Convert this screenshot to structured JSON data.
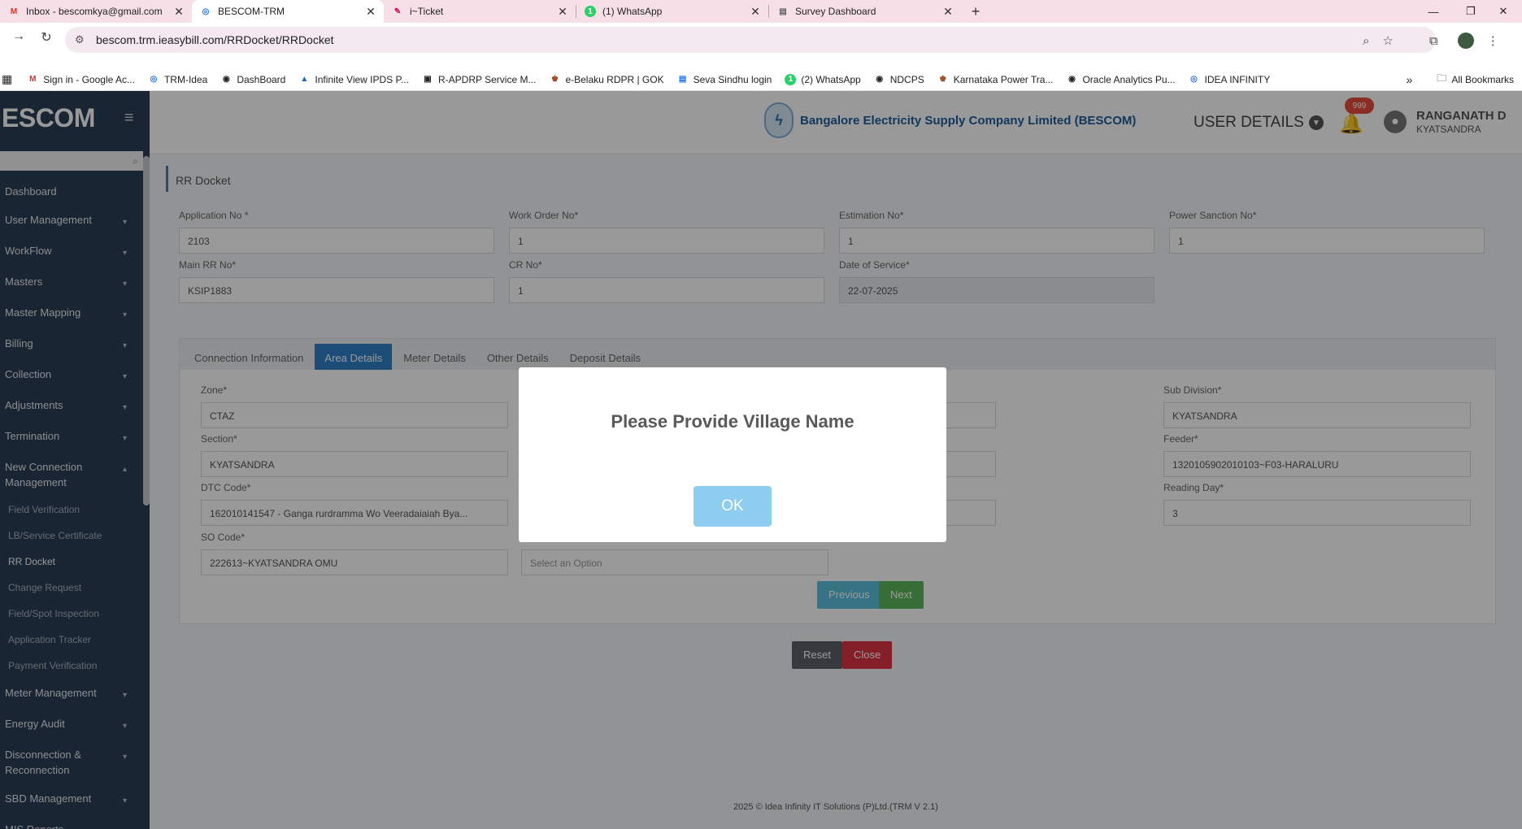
{
  "browser": {
    "tabs": [
      {
        "title": "Inbox - bescomkya@gmail.com",
        "icon": "gmail-icon",
        "color": "#d93025"
      },
      {
        "title": "BESCOM-TRM",
        "icon": "globe-icon",
        "color": "#1a73e8"
      },
      {
        "title": "i~Ticket",
        "icon": "ticket-icon",
        "color": "#c2185b"
      },
      {
        "title": "(1) WhatsApp",
        "icon": "whatsapp-icon",
        "color": "#25d366"
      },
      {
        "title": "Survey Dashboard",
        "icon": "doc-icon",
        "color": "#5f6368"
      }
    ],
    "url": "bescom.trm.ieasybill.com/RRDocket/RRDocket",
    "bookmarks": [
      "Sign in - Google Ac...",
      "TRM-Idea",
      "DashBoard",
      "Infinite View IPDS P...",
      "R-APDRP Service M...",
      "e-Belaku RDPR | GOK",
      "Seva Sindhu login",
      "(2) WhatsApp",
      "NDCPS",
      "Karnataka Power Tra...",
      "Oracle Analytics Pu...",
      "IDEA INFINITY"
    ],
    "all_bookmarks": "All Bookmarks"
  },
  "sidebar": {
    "brand": "ESCOM",
    "menu": [
      {
        "label": "Dashboard",
        "chevron": false
      },
      {
        "label": "User Management",
        "chevron": true
      },
      {
        "label": "WorkFlow",
        "chevron": true
      },
      {
        "label": "Masters",
        "chevron": true
      },
      {
        "label": "Master Mapping",
        "chevron": true
      },
      {
        "label": "Billing",
        "chevron": true
      },
      {
        "label": "Collection",
        "chevron": true
      },
      {
        "label": "Adjustments",
        "chevron": true
      },
      {
        "label": "Termination",
        "chevron": true
      },
      {
        "label": "New Connection Management",
        "chevron": true
      }
    ],
    "submenu": [
      {
        "label": "Field Verification",
        "current": false
      },
      {
        "label": "LB/Service Certificate",
        "current": false
      },
      {
        "label": "RR Docket",
        "current": true
      },
      {
        "label": "Change Request",
        "current": false
      },
      {
        "label": "Field/Spot Inspection",
        "current": false
      },
      {
        "label": "Application Tracker",
        "current": false
      },
      {
        "label": "Payment Verification",
        "current": false
      }
    ],
    "menu_after": [
      {
        "label": "Meter Management",
        "chevron": true
      },
      {
        "label": "Energy Audit",
        "chevron": true
      },
      {
        "label": "Disconnection & Reconnection",
        "chevron": true
      },
      {
        "label": "SBD Management",
        "chevron": true
      },
      {
        "label": "MIS Reports",
        "chevron": true
      }
    ]
  },
  "header": {
    "company": "Bangalore Electricity Supply Company Limited (BESCOM)",
    "user_details": "USER DETAILS",
    "notification_count": "999",
    "user_name": "RANGANATH D",
    "user_location": "KYATSANDRA"
  },
  "page": {
    "title": "RR Docket",
    "fields": {
      "application_no": {
        "label": "Application No *",
        "value": "2103"
      },
      "work_order_no": {
        "label": "Work Order No*",
        "value": "1"
      },
      "estimation_no": {
        "label": "Estimation No*",
        "value": "1"
      },
      "power_sanction_no": {
        "label": "Power Sanction No*",
        "value": "1"
      },
      "main_rr_no": {
        "label": "Main RR No*",
        "value": "KSIP1883"
      },
      "cr_no": {
        "label": "CR No*",
        "value": "1"
      },
      "date_of_service": {
        "label": "Date of Service*",
        "value": "22-07-2025"
      }
    },
    "tabs": [
      {
        "label": "Connection Information",
        "active": false
      },
      {
        "label": "Area Details",
        "active": true
      },
      {
        "label": "Meter Details",
        "active": false
      },
      {
        "label": "Other Details",
        "active": false
      },
      {
        "label": "Deposit Details",
        "active": false
      }
    ],
    "area": {
      "zone": {
        "label": "Zone*",
        "value": "CTAZ"
      },
      "sub_division": {
        "label": "Sub Division*",
        "value": "KYATSANDRA"
      },
      "section": {
        "label": "Section*",
        "value": "KYATSANDRA"
      },
      "feeder": {
        "label": "Feeder*",
        "value": "1320105902010103~F03-HARALURU"
      },
      "dtc_code": {
        "label": "DTC Code*",
        "value": "162010141547 - Ganga rurdramma Wo Veeradaiaiah Bya..."
      },
      "reading_day": {
        "label": "Reading Day*",
        "value": "3"
      },
      "so_code": {
        "label": "SO Code*",
        "value": "222613~KYATSANDRA OMU"
      },
      "village_placeholder": "Select an Option"
    },
    "buttons": {
      "previous": "Previous",
      "next": "Next",
      "reset": "Reset",
      "close": "Close"
    },
    "footer": "2025 © Idea Infinity IT Solutions (P)Ltd.(TRM V 2.1)"
  },
  "modal": {
    "message": "Please Provide Village Name",
    "ok_label": "OK"
  }
}
